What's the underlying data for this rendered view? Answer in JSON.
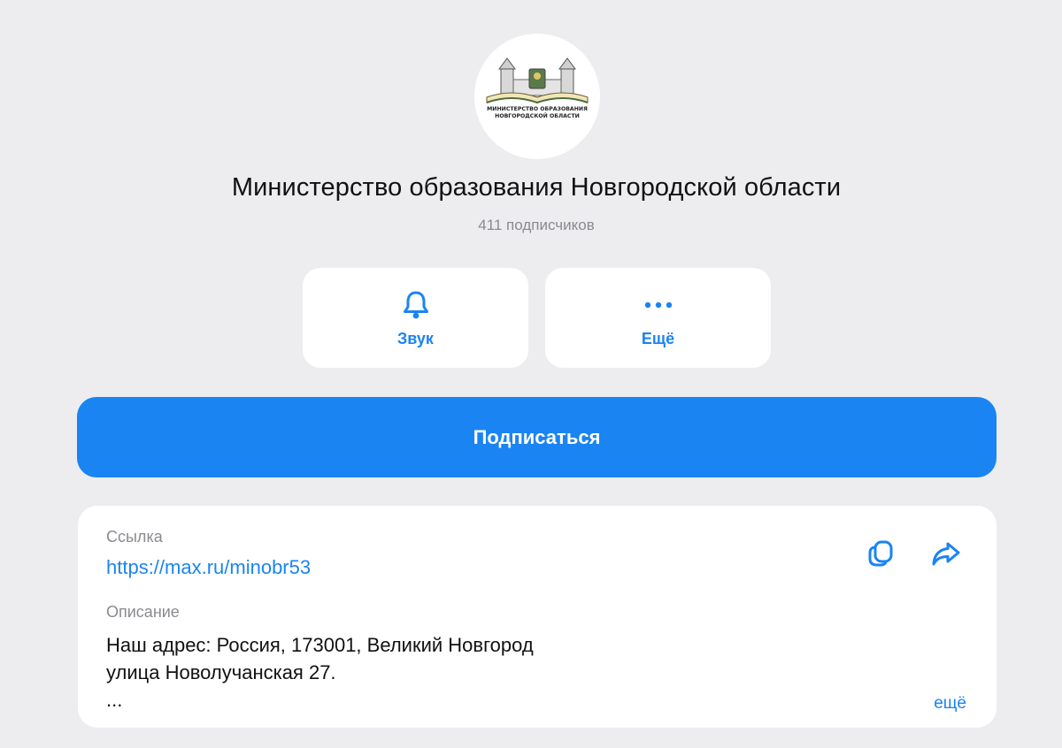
{
  "channel": {
    "title": "Министерство образования Новгородской области",
    "subscribers": "411 подписчиков",
    "logo": {
      "line1": "МИНИСТЕРСТВО ОБРАЗОВАНИЯ",
      "line2": "НОВГОРОДСКОЙ ОБЛАСТИ"
    }
  },
  "actions": {
    "sound_label": "Звук",
    "more_label": "Ещё"
  },
  "subscribe": {
    "label": "Подписаться"
  },
  "info": {
    "link_label": "Ссылка",
    "link_value": "https://max.ru/minobr53",
    "description_label": "Описание",
    "description_line1": "Наш адрес: Россия, 173001, Великий Новгород",
    "description_line2": "улица Новолучанская 27.",
    "description_line3": "...",
    "more_label": "ещё"
  },
  "icons": {
    "sound": "bell-icon",
    "more": "more-dots-icon",
    "copy": "copy-icon",
    "share": "share-icon"
  },
  "colors": {
    "background": "#ededf0",
    "accent": "#1a84f3",
    "card": "#ffffff",
    "muted_text": "#8a8a90"
  }
}
